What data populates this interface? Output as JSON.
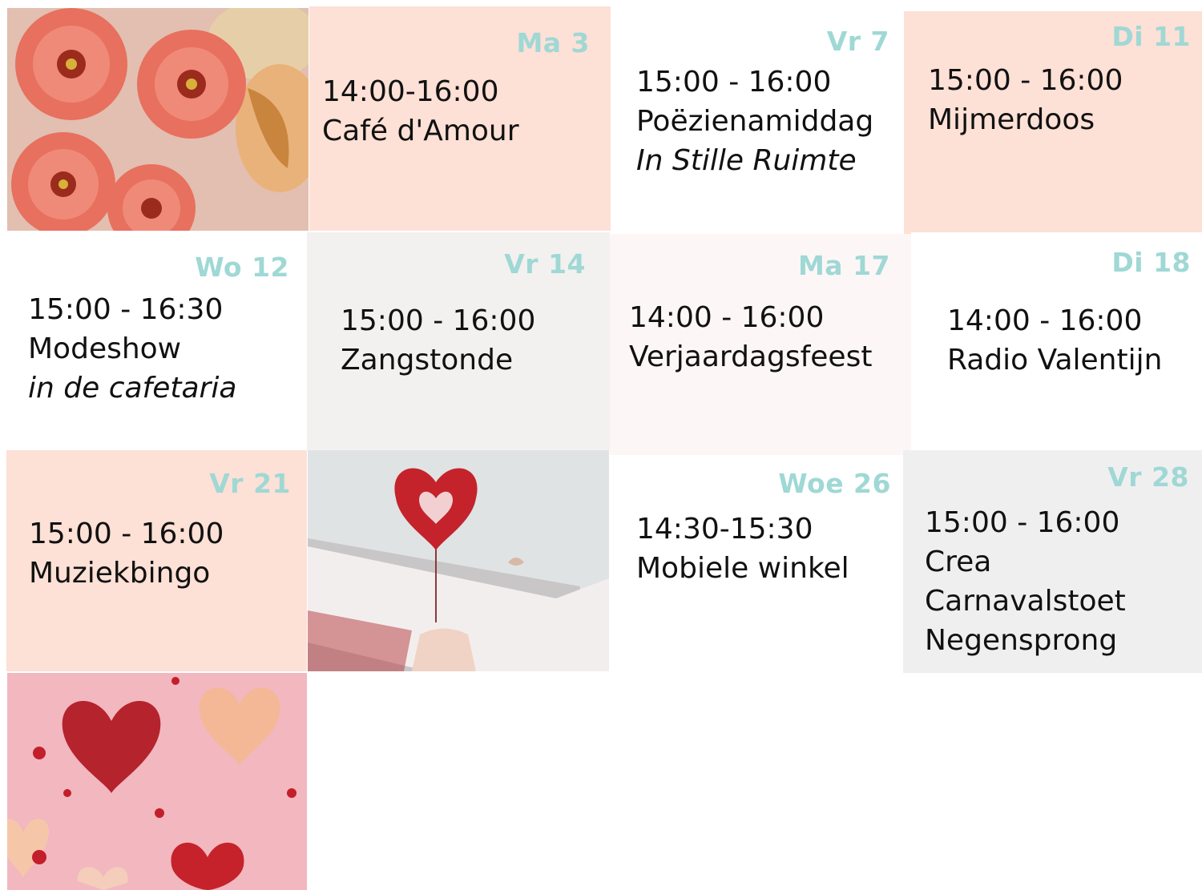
{
  "colors": {
    "date": "#9fd8d5",
    "peach": "#fde0d6",
    "grey": "#f2f1f0",
    "pink_light": "#fdf6f6",
    "white": "#ffffff"
  },
  "photos": {
    "flowers": "flowers-photo",
    "popup_card": "heart-popup-card-photo",
    "paper_hearts": "paper-hearts-photo"
  },
  "events": [
    {
      "date": "Ma 3",
      "time": "14:00-16:00",
      "lines": [
        "Café d'Amour"
      ]
    },
    {
      "date": "Vr 7",
      "time": "15:00 - 16:00",
      "lines": [
        "Poëzienamiddag"
      ],
      "note": "In Stille Ruimte"
    },
    {
      "date": "Di 11",
      "time": "15:00 - 16:00",
      "lines": [
        "Mijmerdoos"
      ]
    },
    {
      "date": "Wo 12",
      "time": "15:00 - 16:30",
      "lines": [
        "Modeshow"
      ],
      "note": "in de cafetaria"
    },
    {
      "date": "Vr 14",
      "time": "15:00 - 16:00",
      "lines": [
        "Zangstonde"
      ]
    },
    {
      "date": "Ma 17",
      "time": "14:00 - 16:00",
      "lines": [
        "Verjaardagsfeest"
      ]
    },
    {
      "date": "Di 18",
      "time": "14:00 - 16:00",
      "lines": [
        "Radio Valentijn"
      ]
    },
    {
      "date": "Vr 21",
      "time": "15:00 - 16:00",
      "lines": [
        "Muziekbingo"
      ]
    },
    {
      "date": "Woe 26",
      "time": "14:30-15:30",
      "lines": [
        "Mobiele winkel"
      ]
    },
    {
      "date": "Vr 28",
      "time": "15:00 - 16:00",
      "lines": [
        "Crea",
        "Carnavalstoet",
        "Negensprong"
      ]
    }
  ]
}
